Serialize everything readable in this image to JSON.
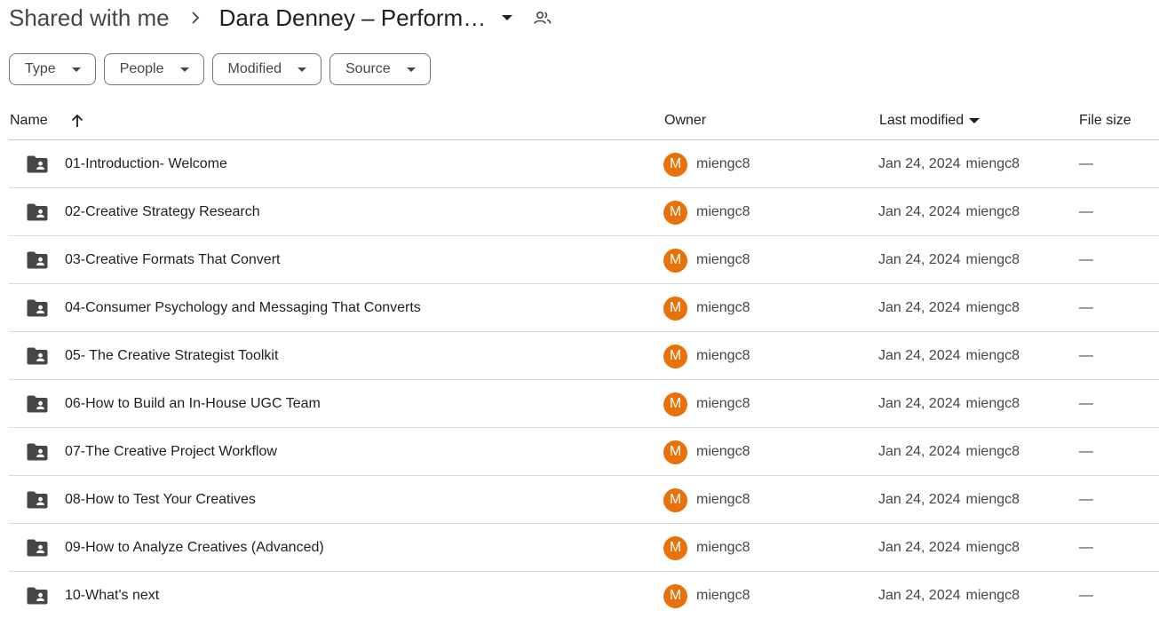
{
  "breadcrumb": {
    "root": "Shared with me",
    "current": "Dara Denney – Perform…"
  },
  "filters": [
    {
      "label": "Type"
    },
    {
      "label": "People"
    },
    {
      "label": "Modified"
    },
    {
      "label": "Source"
    }
  ],
  "columns": {
    "name": "Name",
    "owner": "Owner",
    "last_modified": "Last modified",
    "file_size": "File size"
  },
  "rows": [
    {
      "name": "01-Introduction- Welcome",
      "owner_initial": "M",
      "owner": "miengc8",
      "date": "Jan 24, 2024",
      "modified_by": "miengc8",
      "size": "—"
    },
    {
      "name": "02-Creative Strategy Research",
      "owner_initial": "M",
      "owner": "miengc8",
      "date": "Jan 24, 2024",
      "modified_by": "miengc8",
      "size": "—"
    },
    {
      "name": "03-Creative Formats That Convert",
      "owner_initial": "M",
      "owner": "miengc8",
      "date": "Jan 24, 2024",
      "modified_by": "miengc8",
      "size": "—"
    },
    {
      "name": "04-Consumer Psychology and Messaging That Converts",
      "owner_initial": "M",
      "owner": "miengc8",
      "date": "Jan 24, 2024",
      "modified_by": "miengc8",
      "size": "—"
    },
    {
      "name": "05- The Creative Strategist Toolkit",
      "owner_initial": "M",
      "owner": "miengc8",
      "date": "Jan 24, 2024",
      "modified_by": "miengc8",
      "size": "—"
    },
    {
      "name": "06-How to Build an In-House UGC Team",
      "owner_initial": "M",
      "owner": "miengc8",
      "date": "Jan 24, 2024",
      "modified_by": "miengc8",
      "size": "—"
    },
    {
      "name": "07-The Creative Project Workflow",
      "owner_initial": "M",
      "owner": "miengc8",
      "date": "Jan 24, 2024",
      "modified_by": "miengc8",
      "size": "—"
    },
    {
      "name": "08-How to Test Your Creatives",
      "owner_initial": "M",
      "owner": "miengc8",
      "date": "Jan 24, 2024",
      "modified_by": "miengc8",
      "size": "—"
    },
    {
      "name": "09-How to Analyze Creatives (Advanced)",
      "owner_initial": "M",
      "owner": "miengc8",
      "date": "Jan 24, 2024",
      "modified_by": "miengc8",
      "size": "—"
    },
    {
      "name": "10-What's next",
      "owner_initial": "M",
      "owner": "miengc8",
      "date": "Jan 24, 2024",
      "modified_by": "miengc8",
      "size": "—"
    }
  ],
  "colors": {
    "avatar": "#e8710a",
    "folder_icon": "#444746"
  },
  "icons": {
    "breadcrumb_separator": "chevron-right-icon",
    "folder_menu": "caret-down-icon",
    "shared": "people-icon",
    "sort": "arrow-up-icon",
    "row_icon": "shared-folder-icon"
  }
}
